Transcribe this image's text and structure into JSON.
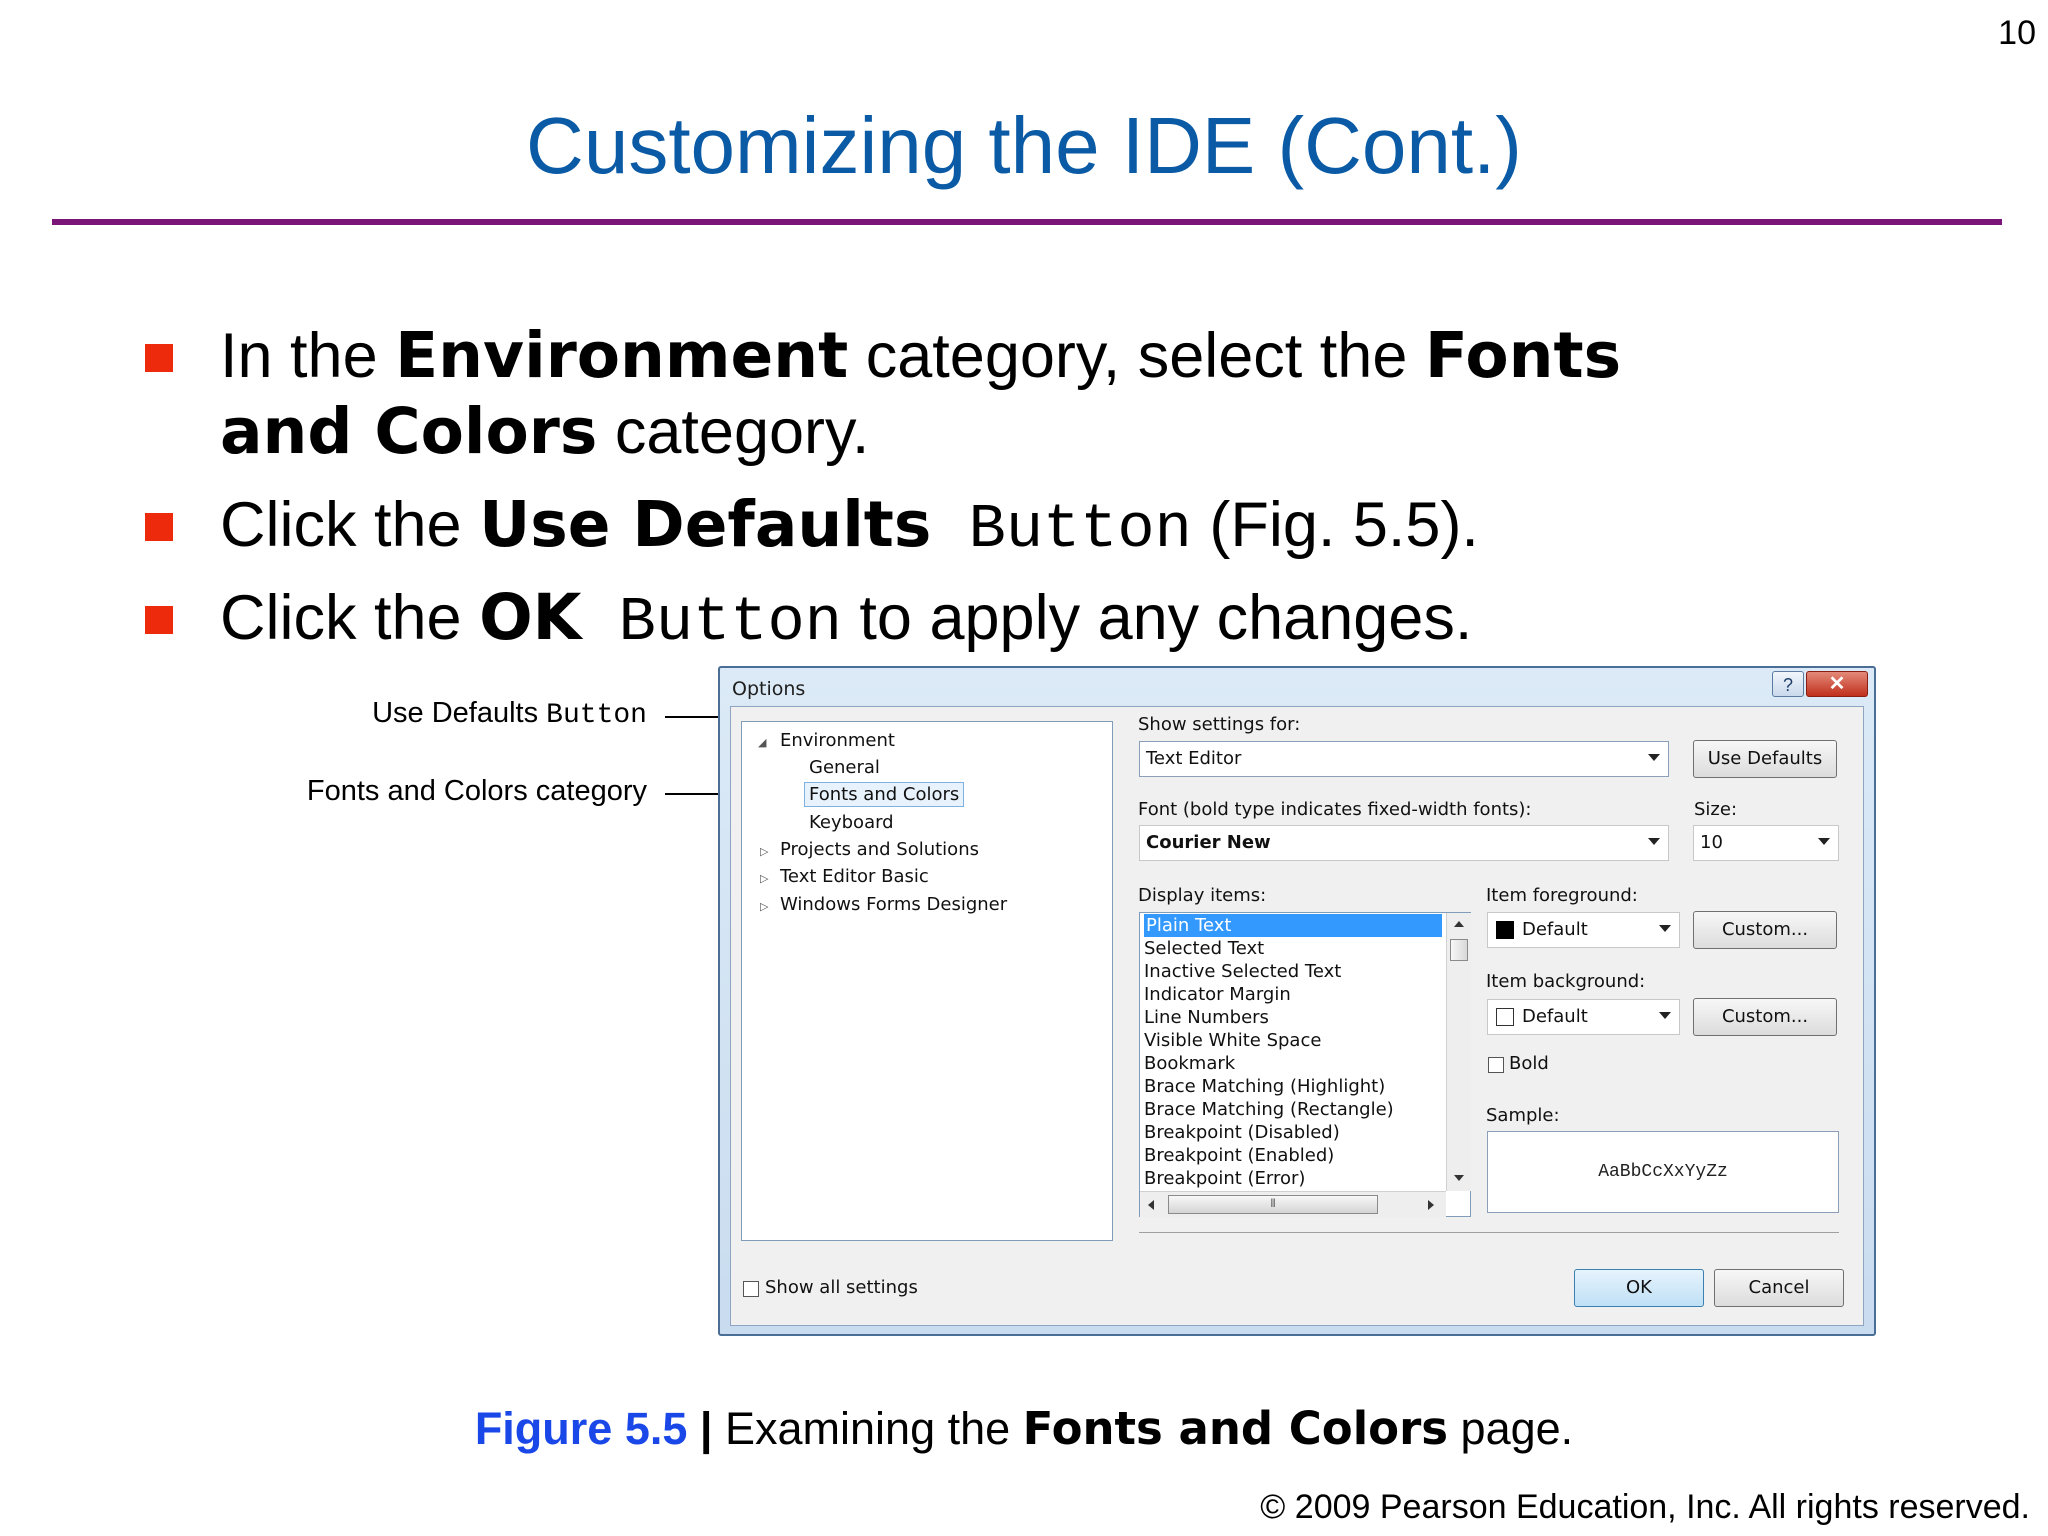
{
  "slide": {
    "page_number": "10",
    "title": "Customizing the IDE (Cont.)",
    "bullets": [
      {
        "t1": "In the ",
        "b1": "Environment",
        "t2": " category, select the ",
        "b2": "Fonts",
        "l2b": "and Colors",
        "l2t": " category."
      },
      {
        "t1": "Click the ",
        "b1": "Use Defaults",
        "m1": " Button",
        "t2": " (Fig. 5.5)."
      },
      {
        "t1": "Click the ",
        "b1": "OK",
        "m1": " Button",
        "t2": " to apply any changes."
      }
    ],
    "callouts": {
      "use_defaults_text": "Use Defaults ",
      "use_defaults_mono": "Button",
      "fonts_colors": "Fonts and Colors category"
    },
    "caption": {
      "fig": "Figure 5.5",
      "sep": " | ",
      "text1": "Examining the ",
      "bold": "Fonts and Colors",
      "text2": " page."
    },
    "copyright": "© 2009 Pearson Education, Inc.  All rights reserved."
  },
  "dialog": {
    "title": "Options",
    "help": "?",
    "close": "✕",
    "tree": {
      "environment": "Environment",
      "general": "General",
      "fonts_colors": "Fonts and Colors",
      "keyboard": "Keyboard",
      "projects": "Projects and Solutions",
      "text_editor_basic": "Text Editor Basic",
      "wf_designer": "Windows Forms Designer"
    },
    "show_settings_label": "Show settings for:",
    "show_settings_value": "Text Editor",
    "use_defaults_btn": "Use Defaults",
    "font_label": "Font (bold type indicates fixed-width fonts):",
    "font_value": "Courier New",
    "size_label": "Size:",
    "size_value": "10",
    "display_items_label": "Display items:",
    "display_items": [
      "Plain Text",
      "Selected Text",
      "Inactive Selected Text",
      "Indicator Margin",
      "Line Numbers",
      "Visible White Space",
      "Bookmark",
      "Brace Matching (Highlight)",
      "Brace Matching (Rectangle)",
      "Breakpoint (Disabled)",
      "Breakpoint (Enabled)",
      "Breakpoint (Error)"
    ],
    "item_fg_label": "Item foreground:",
    "item_fg_value": "Default",
    "item_bg_label": "Item background:",
    "item_bg_value": "Default",
    "custom_fg": "Custom...",
    "custom_bg": "Custom...",
    "bold_label": "Bold",
    "sample_label": "Sample:",
    "sample_text": "AaBbCcXxYyZz",
    "show_all": "Show all settings",
    "ok": "OK",
    "cancel": "Cancel"
  },
  "colors": {
    "title": "#0a5aa5",
    "rule": "#7a1478",
    "bullet": "#ee2a0c",
    "figure_label": "#1a47e8",
    "selection": "#3399ff"
  }
}
